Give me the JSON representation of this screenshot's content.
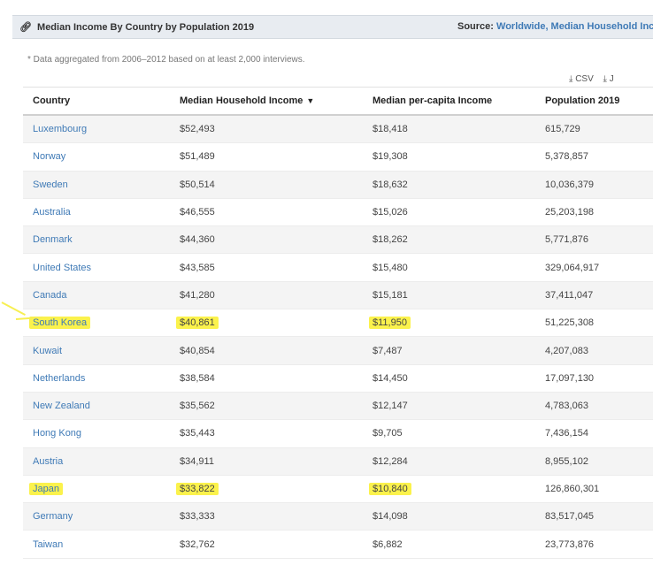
{
  "header": {
    "title": "Median Income By Country by Population 2019",
    "source_label": "Source:",
    "source_link": "Worldwide, Median Household Income Abo"
  },
  "note": "* Data aggregated from 2006–2012 based on at least 2,000 interviews.",
  "downloads": [
    "CSV",
    "J"
  ],
  "table": {
    "headers": [
      "Country",
      "Median Household Income",
      "Median per-capita Income",
      "Population 2019"
    ],
    "rows": [
      {
        "country": "Luxembourg",
        "household": "$52,493",
        "per_capita": "$18,418",
        "population": "615,729",
        "highlight": false
      },
      {
        "country": "Norway",
        "household": "$51,489",
        "per_capita": "$19,308",
        "population": "5,378,857",
        "highlight": false
      },
      {
        "country": "Sweden",
        "household": "$50,514",
        "per_capita": "$18,632",
        "population": "10,036,379",
        "highlight": false
      },
      {
        "country": "Australia",
        "household": "$46,555",
        "per_capita": "$15,026",
        "population": "25,203,198",
        "highlight": false
      },
      {
        "country": "Denmark",
        "household": "$44,360",
        "per_capita": "$18,262",
        "population": "5,771,876",
        "highlight": false
      },
      {
        "country": "United States",
        "household": "$43,585",
        "per_capita": "$15,480",
        "population": "329,064,917",
        "highlight": false
      },
      {
        "country": "Canada",
        "household": "$41,280",
        "per_capita": "$15,181",
        "population": "37,411,047",
        "highlight": false
      },
      {
        "country": "South Korea",
        "household": "$40,861",
        "per_capita": "$11,950",
        "population": "51,225,308",
        "highlight": true
      },
      {
        "country": "Kuwait",
        "household": "$40,854",
        "per_capita": "$7,487",
        "population": "4,207,083",
        "highlight": false
      },
      {
        "country": "Netherlands",
        "household": "$38,584",
        "per_capita": "$14,450",
        "population": "17,097,130",
        "highlight": false
      },
      {
        "country": "New Zealand",
        "household": "$35,562",
        "per_capita": "$12,147",
        "population": "4,783,063",
        "highlight": false
      },
      {
        "country": "Hong Kong",
        "household": "$35,443",
        "per_capita": "$9,705",
        "population": "7,436,154",
        "highlight": false
      },
      {
        "country": "Austria",
        "household": "$34,911",
        "per_capita": "$12,284",
        "population": "8,955,102",
        "highlight": false
      },
      {
        "country": "Japan",
        "household": "$33,822",
        "per_capita": "$10,840",
        "population": "126,860,301",
        "highlight": true
      },
      {
        "country": "Germany",
        "household": "$33,333",
        "per_capita": "$14,098",
        "population": "83,517,045",
        "highlight": false
      },
      {
        "country": "Taiwan",
        "household": "$32,762",
        "per_capita": "$6,882",
        "population": "23,773,876",
        "highlight": false
      }
    ]
  },
  "colors": {
    "link": "#3f7ab6",
    "highlighter": "#fbf24c",
    "header_bg": "#e8ecf1"
  },
  "icons": {
    "title": "link-icon",
    "download": "download-icon",
    "sort": "sort-down-icon"
  }
}
